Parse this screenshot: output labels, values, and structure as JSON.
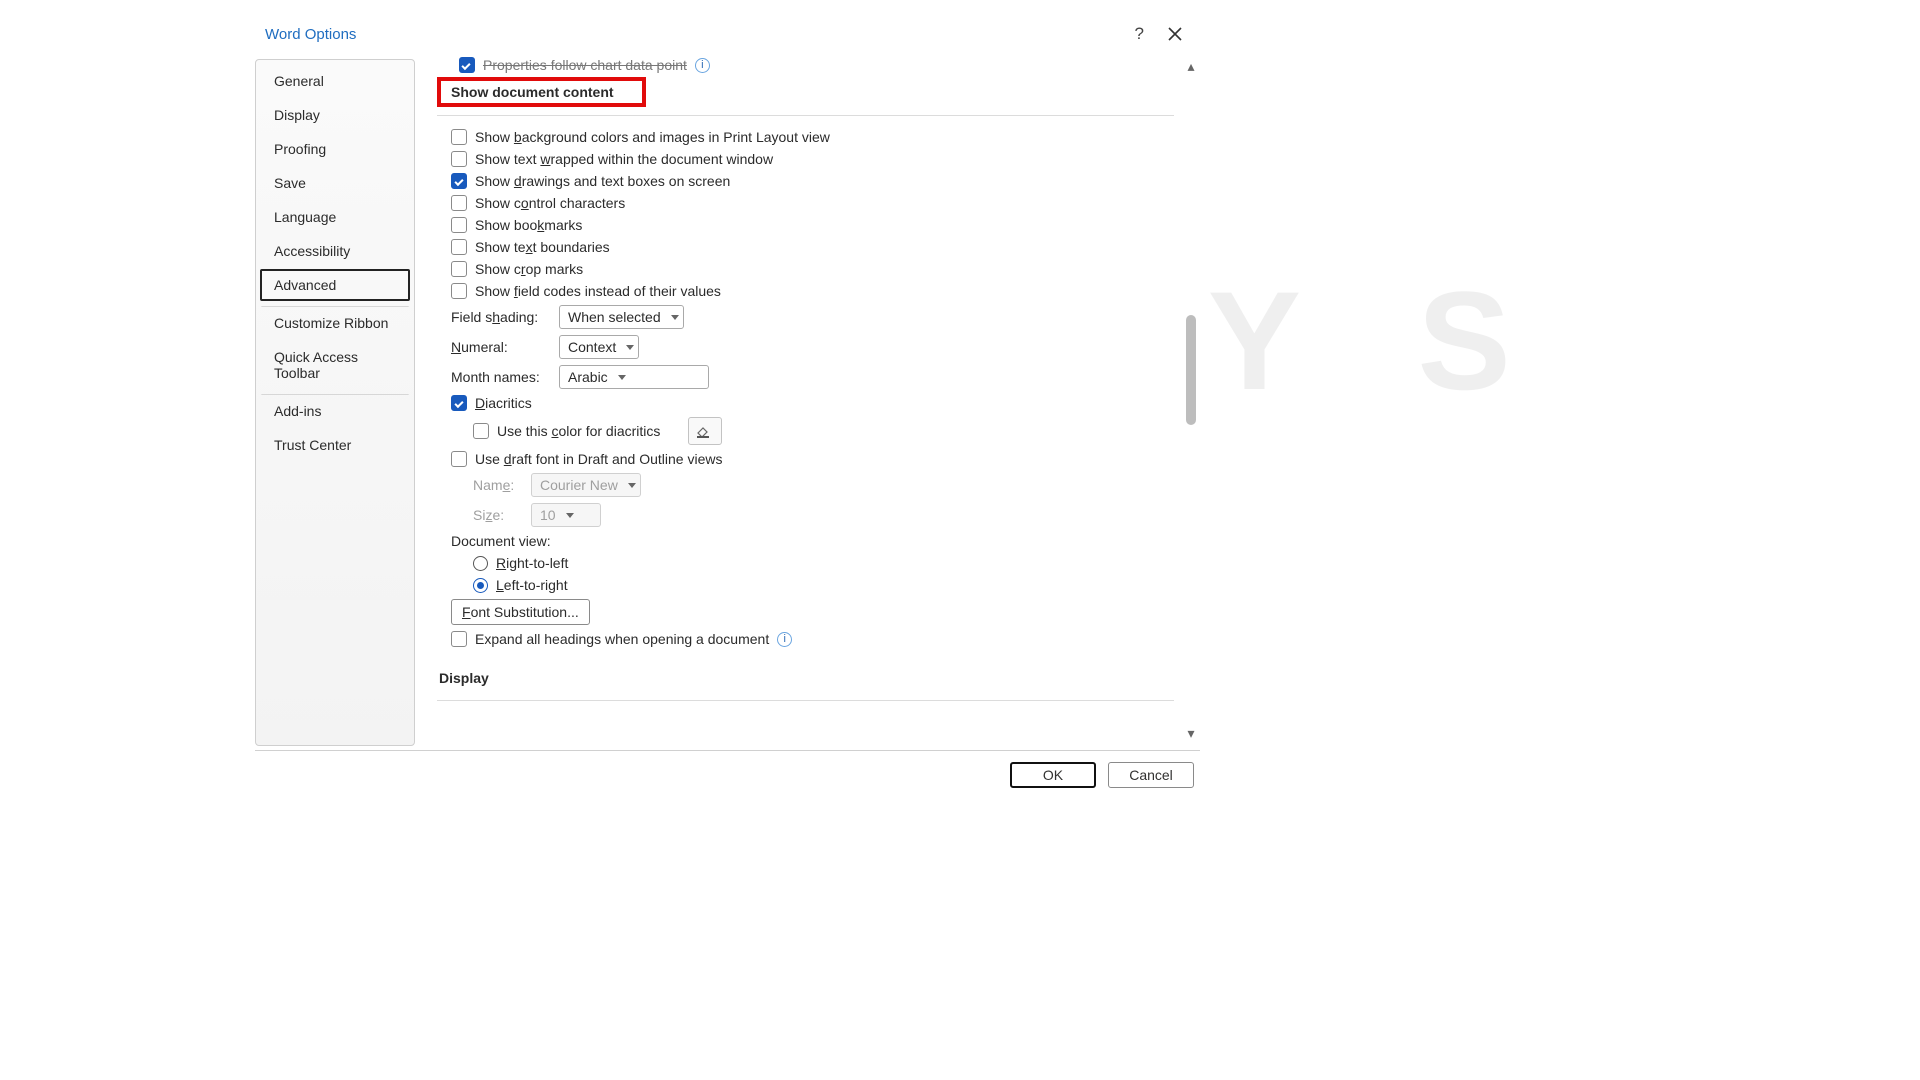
{
  "title": "Word Options",
  "sidebar": {
    "items": [
      {
        "label": "General"
      },
      {
        "label": "Display"
      },
      {
        "label": "Proofing"
      },
      {
        "label": "Save"
      },
      {
        "label": "Language"
      },
      {
        "label": "Accessibility"
      },
      {
        "label": "Advanced",
        "active": true
      },
      {
        "label": "Customize Ribbon"
      },
      {
        "label": "Quick Access Toolbar"
      },
      {
        "label": "Add-ins"
      },
      {
        "label": "Trust Center"
      }
    ]
  },
  "partial_row_label": "Properties follow chart data point",
  "section_heading": "Show document content",
  "options": {
    "bg_colors": {
      "label_pre": "Show ",
      "acc": "b",
      "label_post": "ackground colors and images in Print Layout view",
      "checked": false
    },
    "text_wrap": {
      "label_pre": "Show text ",
      "acc": "w",
      "label_post": "rapped within the document window",
      "checked": false
    },
    "drawings": {
      "label_pre": "Show ",
      "acc": "d",
      "label_post": "rawings and text boxes on screen",
      "checked": true
    },
    "control_chars": {
      "label_pre": "Show c",
      "acc": "o",
      "label_post": "ntrol characters",
      "checked": false
    },
    "bookmarks": {
      "label_pre": "Show boo",
      "acc": "k",
      "label_post": "marks",
      "checked": false
    },
    "text_boundaries": {
      "label_pre": "Show te",
      "acc": "x",
      "label_post": "t boundaries",
      "checked": false
    },
    "crop_marks": {
      "label_pre": "Show c",
      "acc": "r",
      "label_post": "op marks",
      "checked": false
    },
    "field_codes": {
      "label_pre": "Show ",
      "acc": "f",
      "label_post": "ield codes instead of their values",
      "checked": false
    },
    "diacritics": {
      "label_pre": "",
      "acc": "D",
      "label_post": "iacritics",
      "checked": true
    },
    "diacritics_color": {
      "label_pre": "Use this ",
      "acc": "c",
      "label_post": "olor for diacritics",
      "checked": false
    },
    "draft_font": {
      "label_pre": "Use ",
      "acc": "d",
      "label_post": "raft font in Draft and Outline views",
      "checked": false
    },
    "expand_headings": {
      "label_pre": "Expand all headings when opening a document",
      "acc": "",
      "label_post": "",
      "checked": false
    }
  },
  "labels": {
    "field_shading_pre": "Field s",
    "field_shading_acc": "h",
    "field_shading_post": "ading:",
    "numeral_acc": "N",
    "numeral_post": "umeral:",
    "month_names": "Month names:",
    "name_pre": "Nam",
    "name_acc": "e",
    "name_post": ":",
    "size_pre": "Si",
    "size_acc": "z",
    "size_post": "e:",
    "document_view": "Document view:",
    "rtl_acc": "R",
    "rtl_post": "ight-to-left",
    "ltr_acc": "L",
    "ltr_post": "eft-to-right",
    "font_sub_acc": "F",
    "font_sub_post": "ont Substitution..."
  },
  "dropdowns": {
    "field_shading": "When selected",
    "numeral": "Context",
    "month_names": "Arabic",
    "draft_name": "Courier New",
    "draft_size": "10"
  },
  "doc_view_selected": "ltr",
  "next_section": "Display",
  "buttons": {
    "ok": "OK",
    "cancel": "Cancel"
  }
}
